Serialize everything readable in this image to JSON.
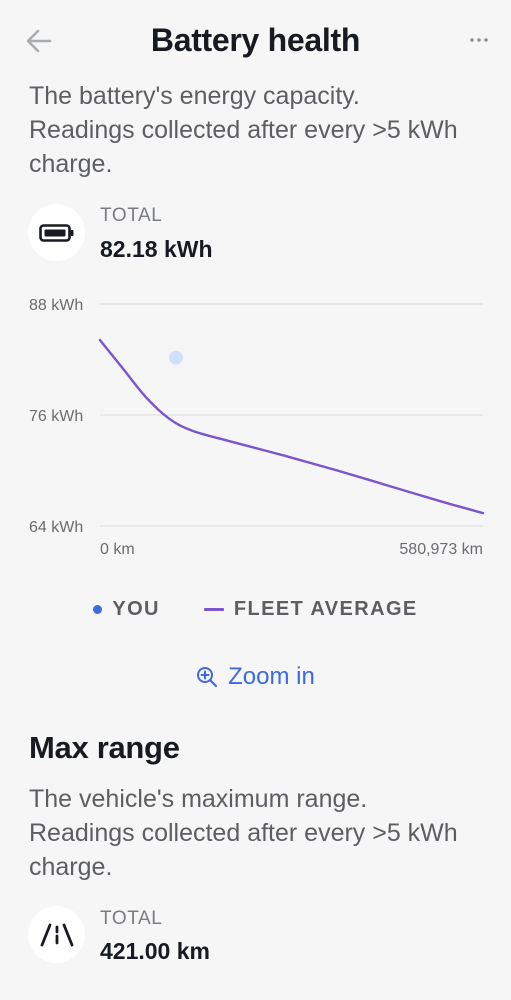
{
  "header": {
    "title": "Battery health"
  },
  "battery": {
    "description": "The battery's energy capacity. Readings collected after every >5 kWh charge.",
    "stat_label": "TOTAL",
    "stat_value": "82.18 kWh",
    "icon": "battery-icon"
  },
  "chart_data": {
    "type": "line",
    "y_ticks": [
      "88 kWh",
      "76 kWh",
      "64 kWh"
    ],
    "ylim": [
      64,
      88
    ],
    "x_ticks": [
      "0 km",
      "580,973 km"
    ],
    "xlim": [
      0,
      580973
    ],
    "grid": true,
    "series": [
      {
        "name": "FLEET AVERAGE",
        "color": "#7b54cf",
        "x": [
          0,
          35000,
          70000,
          105000,
          140000,
          200000,
          280000,
          360000,
          440000,
          520000,
          580973
        ],
        "y": [
          84.1,
          81.0,
          77.9,
          75.6,
          74.3,
          73.1,
          71.6,
          70.0,
          68.3,
          66.6,
          65.4
        ]
      },
      {
        "name": "YOU",
        "color": "#cfe0fb",
        "x": [
          100000
        ],
        "y": [
          82.2
        ]
      }
    ],
    "legend": [
      "YOU",
      "FLEET AVERAGE"
    ]
  },
  "legend": {
    "you": "YOU",
    "fleet": "FLEET AVERAGE",
    "you_color": "#3e6ae1",
    "fleet_color": "#7b54cf"
  },
  "zoom": {
    "label": "Zoom in",
    "icon": "zoom-in-icon"
  },
  "range": {
    "title": "Max range",
    "description": "The vehicle's maximum range. Readings collected after every >5 kWh charge.",
    "stat_label": "TOTAL",
    "stat_value": "421.00 km",
    "icon": "road-icon"
  },
  "colors": {
    "accent": "#3e6ae1",
    "background": "#f6f6f7"
  }
}
